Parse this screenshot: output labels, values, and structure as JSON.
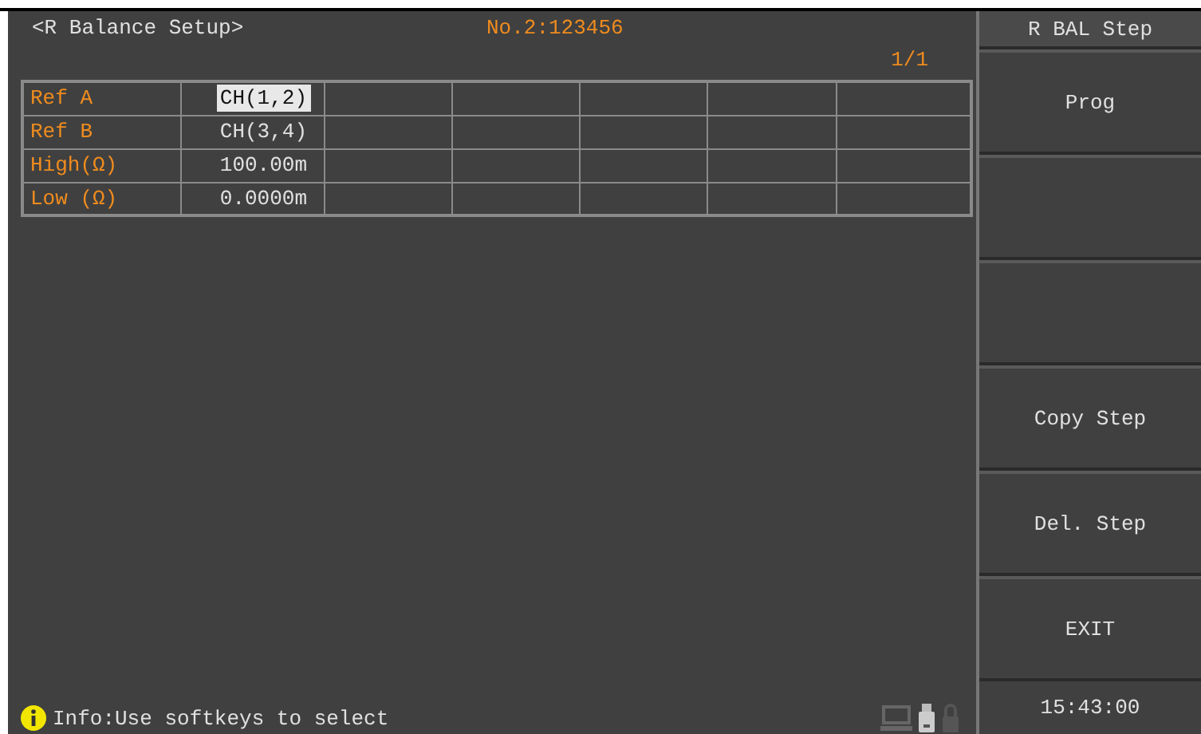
{
  "header": {
    "title": "<R Balance Setup>",
    "file": "No.2:123456",
    "page": "1/1"
  },
  "table": {
    "rows": [
      {
        "label": "Ref A",
        "value": "CH(1,2)",
        "selected": true
      },
      {
        "label": "Ref B",
        "value": "CH(3,4)",
        "selected": false
      },
      {
        "label": "High(Ω)",
        "value": "100.00m",
        "selected": false
      },
      {
        "label": "Low (Ω)",
        "value": "0.0000m",
        "selected": false
      }
    ]
  },
  "softkeys": {
    "title": "R BAL Step",
    "keys": [
      {
        "kind": "labeled",
        "label": "Prog"
      },
      {
        "kind": "blank"
      },
      {
        "kind": "blank"
      },
      {
        "kind": "labeled",
        "label": "Copy Step"
      },
      {
        "kind": "labeled",
        "label": "Del. Step"
      },
      {
        "kind": "labeled",
        "label": "EXIT"
      }
    ]
  },
  "status_bar": {
    "message": "Info:Use softkeys to select",
    "time": "15:43:00"
  }
}
